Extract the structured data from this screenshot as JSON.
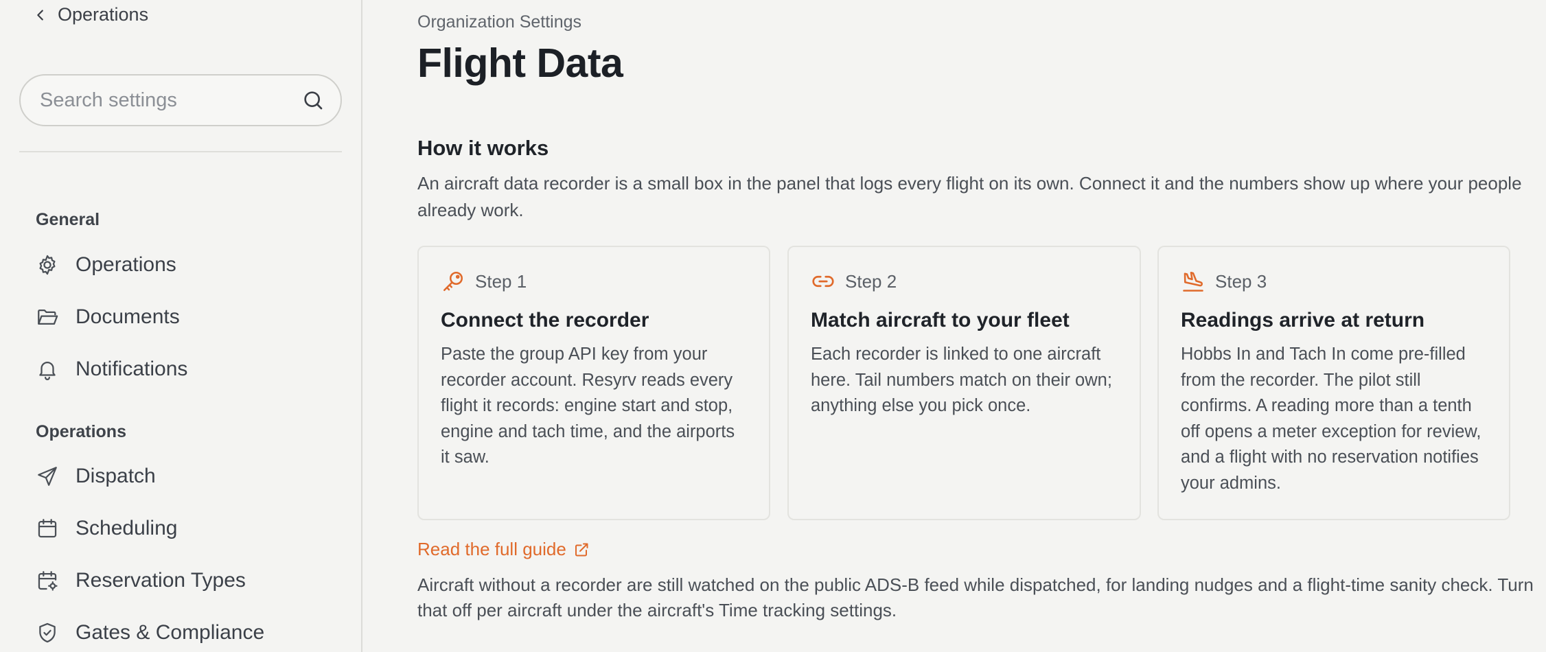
{
  "sidebar": {
    "back_label": "Operations",
    "search": {
      "placeholder": "Search settings",
      "value": ""
    },
    "sections": [
      {
        "title": "General",
        "items": [
          {
            "label": "Operations",
            "icon": "gear-icon"
          },
          {
            "label": "Documents",
            "icon": "folder-icon"
          },
          {
            "label": "Notifications",
            "icon": "bell-icon"
          }
        ]
      },
      {
        "title": "Operations",
        "items": [
          {
            "label": "Dispatch",
            "icon": "send-icon"
          },
          {
            "label": "Scheduling",
            "icon": "calendar-icon"
          },
          {
            "label": "Reservation Types",
            "icon": "calendar-settings-icon"
          },
          {
            "label": "Gates & Compliance",
            "icon": "shield-check-icon"
          }
        ]
      }
    ]
  },
  "main": {
    "breadcrumb": "Organization Settings",
    "title": "Flight Data",
    "how_it_works": {
      "title": "How it works",
      "description": "An aircraft data recorder is a small box in the panel that logs every flight on its own. Connect it and the numbers show up where your people already work."
    },
    "steps": [
      {
        "step": "Step 1",
        "icon": "key-icon",
        "title": "Connect the recorder",
        "body": "Paste the group API key from your recorder account. Resyrv reads every flight it records: engine start and stop, engine and tach time, and the airports it saw."
      },
      {
        "step": "Step 2",
        "icon": "link-icon",
        "title": "Match aircraft to your fleet",
        "body": "Each recorder is linked to one aircraft here. Tail numbers match on their own; anything else you pick once."
      },
      {
        "step": "Step 3",
        "icon": "plane-landing-icon",
        "title": "Readings arrive at return",
        "body": "Hobbs In and Tach In come pre-filled from the recorder. The pilot still confirms. A reading more than a tenth off opens a meter exception for review, and a flight with no reservation notifies your admins."
      }
    ],
    "guide_link": "Read the full guide",
    "footnote": "Aircraft without a recorder are still watched on the public ADS-B feed while dispatched, for landing nudges and a flight-time sanity check. Turn that off per aircraft under the aircraft's Time tracking settings."
  },
  "colors": {
    "accent": "#e06a2b",
    "text": "#1f2329",
    "muted": "#4a4f56",
    "background": "#f4f4f2"
  }
}
